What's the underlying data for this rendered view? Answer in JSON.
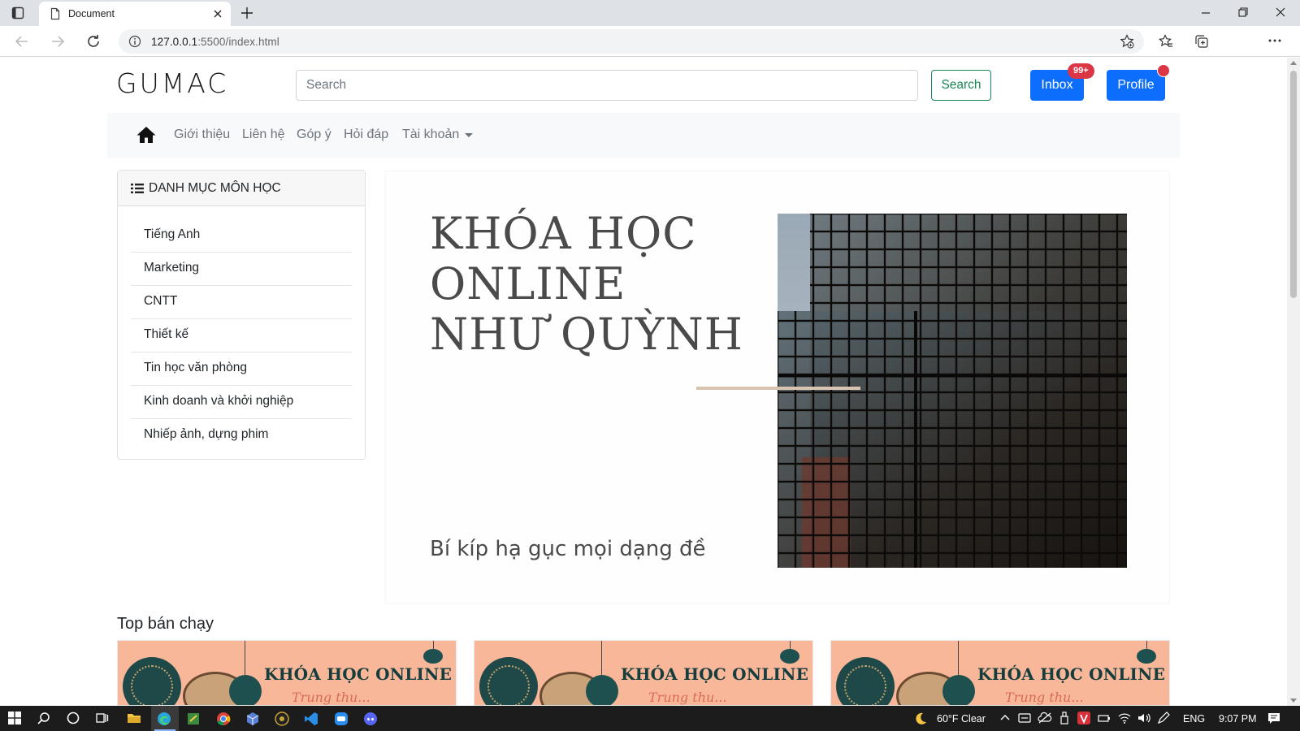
{
  "browser": {
    "tab_title": "Document",
    "url_host": "127.0.0.1",
    "url_rest": ":5500/index.html"
  },
  "header": {
    "logo": "GUMAC",
    "search_placeholder": "Search",
    "search_button": "Search",
    "inbox_label": "Inbox",
    "inbox_badge": "99+",
    "profile_label": "Profile"
  },
  "nav": {
    "items": [
      {
        "label": "Giới thiệu"
      },
      {
        "label": "Liên hệ"
      },
      {
        "label": "Góp ý"
      },
      {
        "label": "Hỏi đáp"
      },
      {
        "label": "Tài khoản"
      }
    ]
  },
  "categories": {
    "title": "DANH MỤC MÔN HỌC",
    "items": [
      "Tiếng Anh",
      "Marketing",
      "CNTT",
      "Thiết kế",
      "Tin học văn phòng",
      "Kinh doanh và khởi nghiệp",
      "Nhiếp ảnh, dựng phim"
    ]
  },
  "banner": {
    "line1": "KHÓA HỌC",
    "line2": "ONLINE",
    "line3": "NHƯ QUỲNH",
    "subtitle": "Bí kíp hạ gục mọi dạng đề"
  },
  "bestsellers": {
    "title": "Top bán chạy",
    "cards": [
      {
        "title": "KHÓA HỌC ONLINE",
        "subtitle": "Trung thu..."
      },
      {
        "title": "KHÓA HỌC ONLINE",
        "subtitle": "Trung thu..."
      },
      {
        "title": "KHÓA HỌC ONLINE",
        "subtitle": "Trung thu..."
      }
    ]
  },
  "taskbar": {
    "weather": "60°F  Clear",
    "language": "ENG",
    "time": "9:07 PM"
  },
  "colors": {
    "primary": "#0d6efd",
    "success": "#198754",
    "danger": "#dc3545",
    "banner_text": "#4a4a4a",
    "card_bg": "#f9b79a"
  }
}
